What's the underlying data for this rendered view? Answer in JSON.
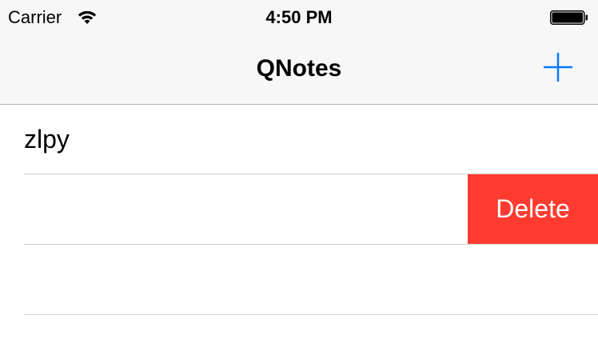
{
  "status_bar": {
    "carrier": "Carrier",
    "time": "4:50 PM",
    "wifi_icon": "wifi-icon",
    "battery_icon": "battery-icon"
  },
  "nav_bar": {
    "title": "QNotes",
    "add_icon": "plus-icon"
  },
  "notes": [
    {
      "title": "zlpy"
    },
    {
      "title": "",
      "swipe_action": "Delete"
    },
    {
      "title": ""
    }
  ],
  "colors": {
    "accent": "#007aff",
    "delete": "#ff3b30",
    "chrome": "#f7f7f7",
    "separator": "#cfcfcf"
  }
}
